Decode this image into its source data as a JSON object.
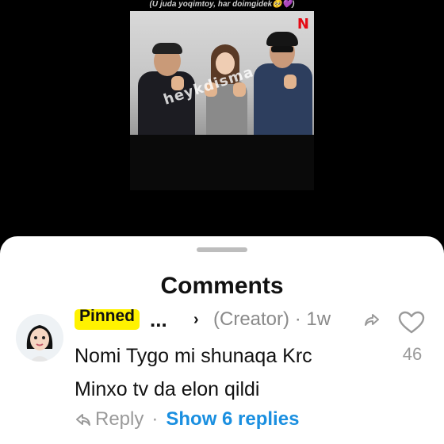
{
  "video": {
    "caption": "(U juda yoqimtoy, har doimgidek🥺💜)",
    "brand_mark": "N",
    "watermark": "heykdisma"
  },
  "comments_sheet": {
    "title": "Comments",
    "comment": {
      "pinned_label": "Pinned",
      "author_truncated": "...",
      "creator_label": "(Creator)",
      "time": "1w",
      "text_line1": "Nomi Tygo mi shunaqa Krc",
      "text_line2": "Minxo tv da elon qildi",
      "like_count": "46",
      "reply_label": "Reply",
      "show_replies_label": "Show 6 replies"
    }
  },
  "colors": {
    "sheet_bg": "#ffffff",
    "pinned_bg": "#fff200",
    "link_blue": "#1a8fe0",
    "muted_gray": "#9a9a9a",
    "netflix_red": "#e50914"
  },
  "icons": {
    "share": "share-arrow-icon",
    "like": "heart-outline-icon",
    "reply": "reply-arrow-icon",
    "chevron": "chevron-right-icon"
  }
}
